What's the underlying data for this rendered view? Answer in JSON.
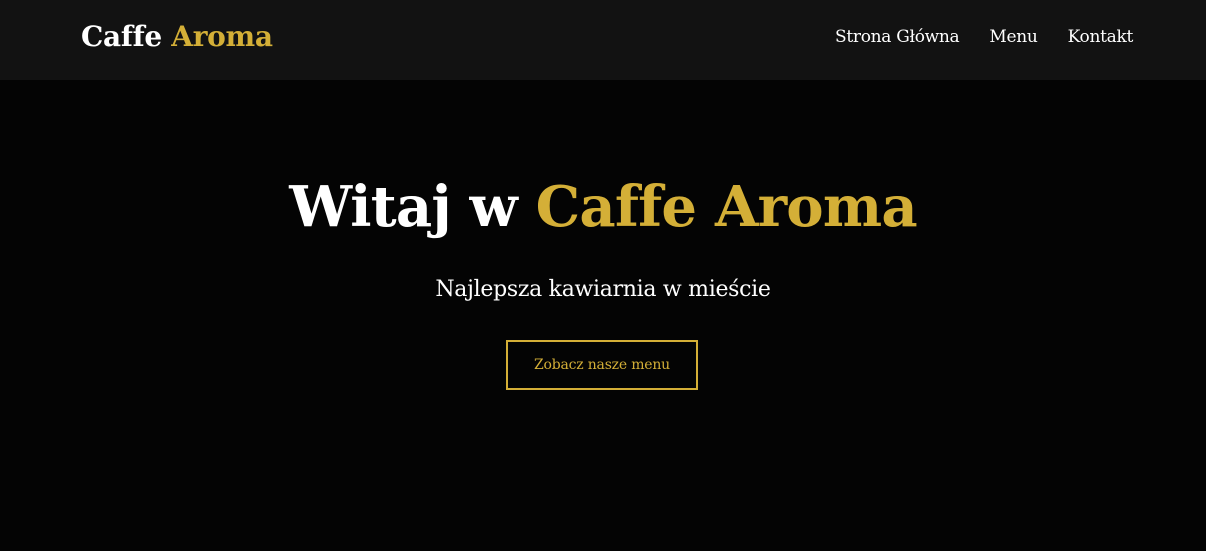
{
  "colors": {
    "accent": "#d4af37",
    "header_bg": "#121212",
    "page_bg": "#040404",
    "text": "#ffffff"
  },
  "header": {
    "logo_part1": "Caffe",
    "logo_part2": "Aroma",
    "nav": [
      {
        "label": "Strona Główna"
      },
      {
        "label": "Menu"
      },
      {
        "label": "Kontakt"
      }
    ]
  },
  "hero": {
    "title_part1": "Witaj w",
    "title_part2": "Caffe Aroma",
    "subtitle": "Najlepsza kawiarnia w mieście",
    "cta_label": "Zobacz nasze menu"
  }
}
